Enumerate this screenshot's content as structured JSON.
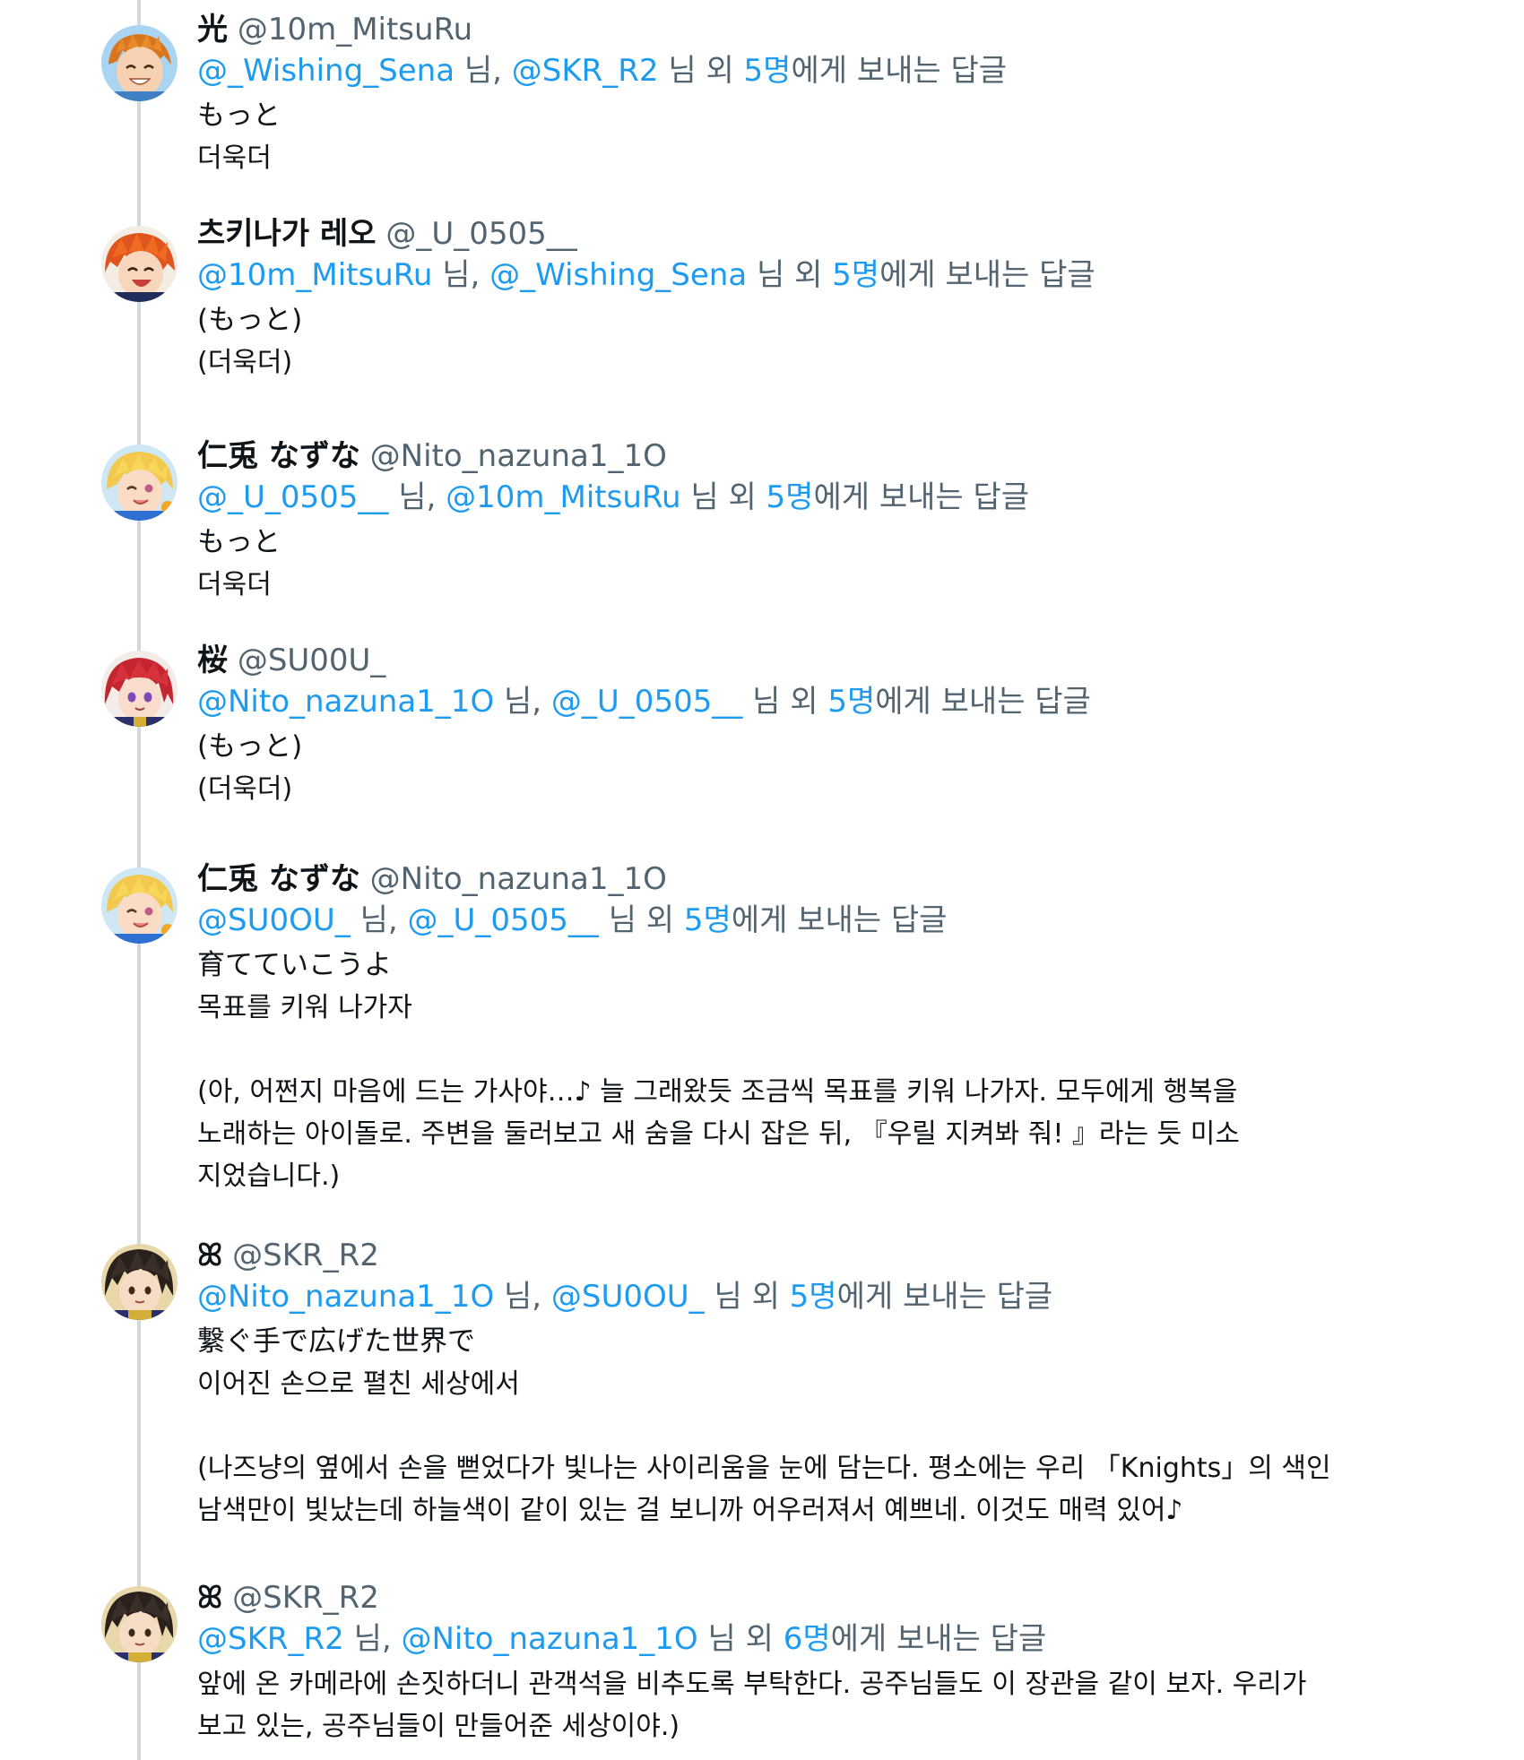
{
  "reply_text": {
    "to_prefix": "",
    "nim": "님,",
    "nim_end": "님",
    "oe": "외",
    "suffix": "에게 보내는 답글"
  },
  "tweets": [
    {
      "display_name": "光",
      "handle": "@10m_MitsuRu",
      "reply_mention_1": "@_Wishing_Sena",
      "reply_mention_2": "@SKR_R2",
      "reply_count": "5명",
      "lines": [
        "もっと",
        "더욱더"
      ],
      "avatar_icon": "avatar-orange-hair-smiling"
    },
    {
      "display_name": "츠키나가 레오",
      "handle": "@_U_0505__",
      "reply_mention_1": "@10m_MitsuRu",
      "reply_mention_2": "@_Wishing_Sena",
      "reply_count": "5명",
      "lines": [
        "(もっと)",
        "(더욱더)"
      ],
      "avatar_icon": "avatar-red-orange-hair-laughing"
    },
    {
      "display_name": "仁兎 なずな",
      "handle": "@Nito_nazuna1_1O",
      "reply_mention_1": "@_U_0505__",
      "reply_mention_2": "@10m_MitsuRu",
      "reply_count": "5명",
      "lines": [
        "もっと",
        "더욱더"
      ],
      "avatar_icon": "avatar-blonde-hair-winking"
    },
    {
      "display_name": "桜",
      "handle": "@SU00U_",
      "reply_mention_1": "@Nito_nazuna1_1O",
      "reply_mention_2": "@_U_0505__",
      "reply_count": "5명",
      "lines": [
        "(もっと)",
        "(더욱더)"
      ],
      "avatar_icon": "avatar-red-hair-purple-eyes"
    },
    {
      "display_name": "仁兎 なずな",
      "handle": "@Nito_nazuna1_1O",
      "reply_mention_1": "@SU0OU_",
      "reply_mention_2": "@_U_0505__",
      "reply_count": "5명",
      "lines": [
        "育てていこうよ",
        "목표를 키워 나가자",
        "",
        "(아, 어쩐지 마음에 드는 가사야…♪ 늘 그래왔듯 조금씩 목표를 키워 나가자. 모두에게 행복을",
        "노래하는 아이돌로. 주변을 둘러보고 새 숨을 다시 잡은 뒤, 『우릴 지켜봐 줘! 』라는 듯 미소",
        "지었습니다.)"
      ],
      "avatar_icon": "avatar-blonde-hair-winking"
    },
    {
      "display_name": "ꕤ",
      "handle": "@SKR_R2",
      "reply_mention_1": "@Nito_nazuna1_1O",
      "reply_mention_2": "@SU0OU_",
      "reply_count": "5명",
      "lines": [
        "繋ぐ手で広げた世界で",
        "이어진 손으로 펼친 세상에서",
        "",
        "(나즈냥의 옆에서 손을 뻗었다가 빛나는 사이리움을 눈에 담는다. 평소에는 우리 「Knights」의 색인",
        "남색만이 빛났는데 하늘색이 같이 있는 걸 보니까 어우러져서 예쁘네. 이것도 매력 있어♪"
      ],
      "avatar_icon": "avatar-dark-hair"
    },
    {
      "display_name": "ꕤ",
      "handle": "@SKR_R2",
      "reply_mention_1": "@SKR_R2",
      "reply_mention_2": "@Nito_nazuna1_1O",
      "reply_count": "6명",
      "lines": [
        "앞에 온 카메라에 손짓하더니 관객석을 비추도록 부탁한다. 공주님들도 이 장관을 같이 보자. 우리가",
        "보고 있는, 공주님들이 만들어준 세상이야.)"
      ],
      "avatar_icon": "avatar-dark-hair"
    }
  ],
  "colors": {
    "accent": "#1d9bf0",
    "secondary_text": "#536471",
    "primary_text": "#0f1419",
    "thread_line": "#cfd9de"
  }
}
